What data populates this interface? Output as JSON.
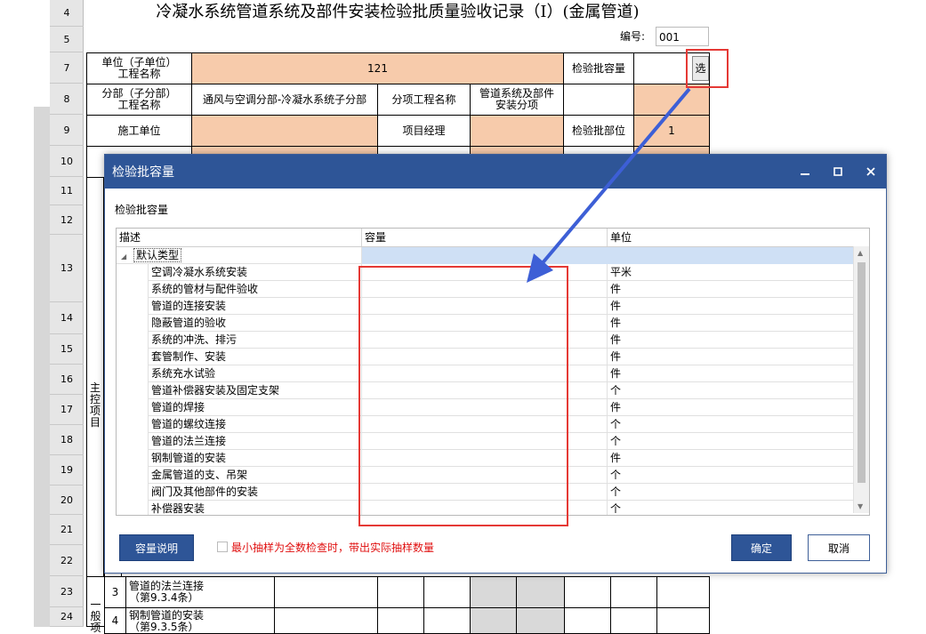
{
  "sheet": {
    "title": "冷凝水系统管道系统及部件安装检验批质量验收记录（Ⅰ）(金属管道)",
    "number_label": "编号:",
    "number_value": "001",
    "row_numbers": [
      "4",
      "5",
      "7",
      "8",
      "9",
      "10",
      "11",
      "12",
      "13",
      "14",
      "15",
      "16",
      "17",
      "18",
      "19",
      "20",
      "21",
      "22",
      "23",
      "24"
    ],
    "unit_label": "单位（子单位）\n工程名称",
    "unit_value": "121",
    "batch_capacity_label": "检验批容量",
    "select_button": "选",
    "sub_label": "分部（子分部）\n工程名称",
    "sub_value": "通风与空调分部-冷凝水系统子分部",
    "item_label": "分项工程名称",
    "item_value": "管道系统及部件\n安装分项",
    "construction_label": "施工单位",
    "manager_label": "项目经理",
    "batch_part_label": "检验批部位",
    "batch_part_value": "1",
    "main_control_label": "主\n控\n项\n目",
    "general_label": "一\n般\n项",
    "row23_no": "3",
    "row23_text": "管道的法兰连接\n（第9.3.4条）",
    "row24_no": "4",
    "row24_text": "钢制管道的安装\n（第9.3.5条）"
  },
  "dialog": {
    "title": "检验批容量",
    "subtitle": "检验批容量",
    "columns": [
      "描述",
      "容量",
      "单位"
    ],
    "group_label": "默认类型",
    "rows": [
      {
        "desc": "空调冷凝水系统安装",
        "capacity": "",
        "unit": "平米"
      },
      {
        "desc": "系统的管材与配件验收",
        "capacity": "",
        "unit": "件"
      },
      {
        "desc": "管道的连接安装",
        "capacity": "",
        "unit": "件"
      },
      {
        "desc": "隐蔽管道的验收",
        "capacity": "",
        "unit": "件"
      },
      {
        "desc": "系统的冲洗、排污",
        "capacity": "",
        "unit": "件"
      },
      {
        "desc": "套管制作、安装",
        "capacity": "",
        "unit": "件"
      },
      {
        "desc": "系统充水试验",
        "capacity": "",
        "unit": "件"
      },
      {
        "desc": "管道补偿器安装及固定支架",
        "capacity": "",
        "unit": "个"
      },
      {
        "desc": "管道的焊接",
        "capacity": "",
        "unit": "件"
      },
      {
        "desc": "管道的螺纹连接",
        "capacity": "",
        "unit": "个"
      },
      {
        "desc": "管道的法兰连接",
        "capacity": "",
        "unit": "个"
      },
      {
        "desc": "钢制管道的安装",
        "capacity": "",
        "unit": "件"
      },
      {
        "desc": "金属管道的支、吊架",
        "capacity": "",
        "unit": "个"
      },
      {
        "desc": "阀门及其他部件的安装",
        "capacity": "",
        "unit": "个"
      },
      {
        "desc": "补偿器安装",
        "capacity": "",
        "unit": "个"
      }
    ],
    "capacity_help_button": "容量说明",
    "min_sample_checkbox_label": "最小抽样为全数检查时，带出实际抽样数量",
    "ok_button": "确定",
    "cancel_button": "取消"
  },
  "colors": {
    "accent": "#2e5597",
    "peach": "#f7cbab",
    "highlight": "#e53935",
    "arrow": "#3d5fd6",
    "selected_row": "#cfe0f5"
  }
}
